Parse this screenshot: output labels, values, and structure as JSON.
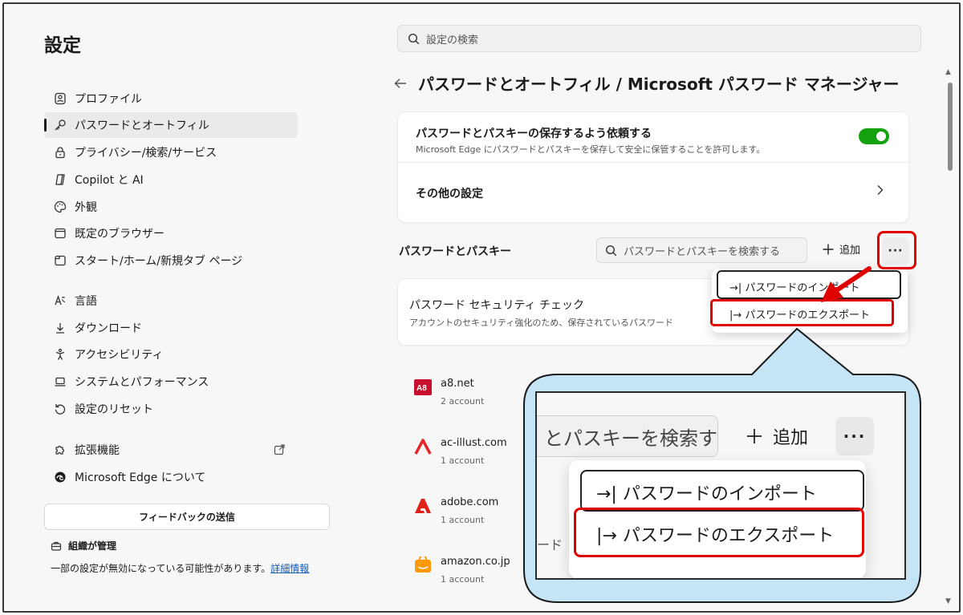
{
  "sidebar": {
    "title": "設定",
    "items": [
      {
        "label": "プロファイル"
      },
      {
        "label": "パスワードとオートフィル"
      },
      {
        "label": "プライバシー/検索/サービス"
      },
      {
        "label": "Copilot と AI"
      },
      {
        "label": "外観"
      },
      {
        "label": "既定のブラウザー"
      },
      {
        "label": "スタート/ホーム/新規タブ ページ"
      },
      {
        "label": "言語"
      },
      {
        "label": "ダウンロード"
      },
      {
        "label": "アクセシビリティ"
      },
      {
        "label": "システムとパフォーマンス"
      },
      {
        "label": "設定のリセット"
      },
      {
        "label": "拡張機能"
      },
      {
        "label": "Microsoft Edge について"
      }
    ],
    "feedback_label": "フィードバックの送信",
    "managed_label": "組織が管理",
    "policy_note": "一部の設定が無効になっている可能性があります。",
    "policy_link": "詳細情報"
  },
  "search": {
    "placeholder": "設定の検索"
  },
  "page": {
    "title": "パスワードとオートフィル / Microsoft パスワード マネージャー"
  },
  "card1": {
    "save_title": "パスワードとパスキーの保存するよう依頼する",
    "save_sub": "Microsoft Edge にパスワードとパスキーを保存して安全に保管することを許可します。",
    "other_settings": "その他の設定"
  },
  "passwords": {
    "section_title": "パスワードとパスキー",
    "search_placeholder": "パスワードとパスキーを検索する",
    "add_label": "追加",
    "more_label": "···"
  },
  "security": {
    "title": "パスワード セキュリティ チェック",
    "sub": "アカウントのセキュリティ強化のため、保存されているパスワード"
  },
  "menu": {
    "import_label": "パスワードのインポート",
    "export_label": "パスワードのエクスポート",
    "import_glyph": "→|",
    "export_glyph": "|→"
  },
  "sites": [
    {
      "name": "a8.net",
      "count": "2 account"
    },
    {
      "name": "ac-illust.com",
      "count": "1 account"
    },
    {
      "name": "adobe.com",
      "count": "1 account"
    },
    {
      "name": "amazon.co.jp",
      "count": "1 account"
    }
  ],
  "zoom": {
    "search_fragment": "とパスキーを検索する",
    "add_label": "追加",
    "more_label": "···",
    "import_label": "パスワードのインポート",
    "export_label": "パスワードのエクスポート",
    "side_fragment": "ード"
  },
  "colors": {
    "accent": "#13a10e",
    "highlight": "#e00000",
    "link": "#0f5cbf",
    "callout_fill": "#c5e4f5"
  }
}
